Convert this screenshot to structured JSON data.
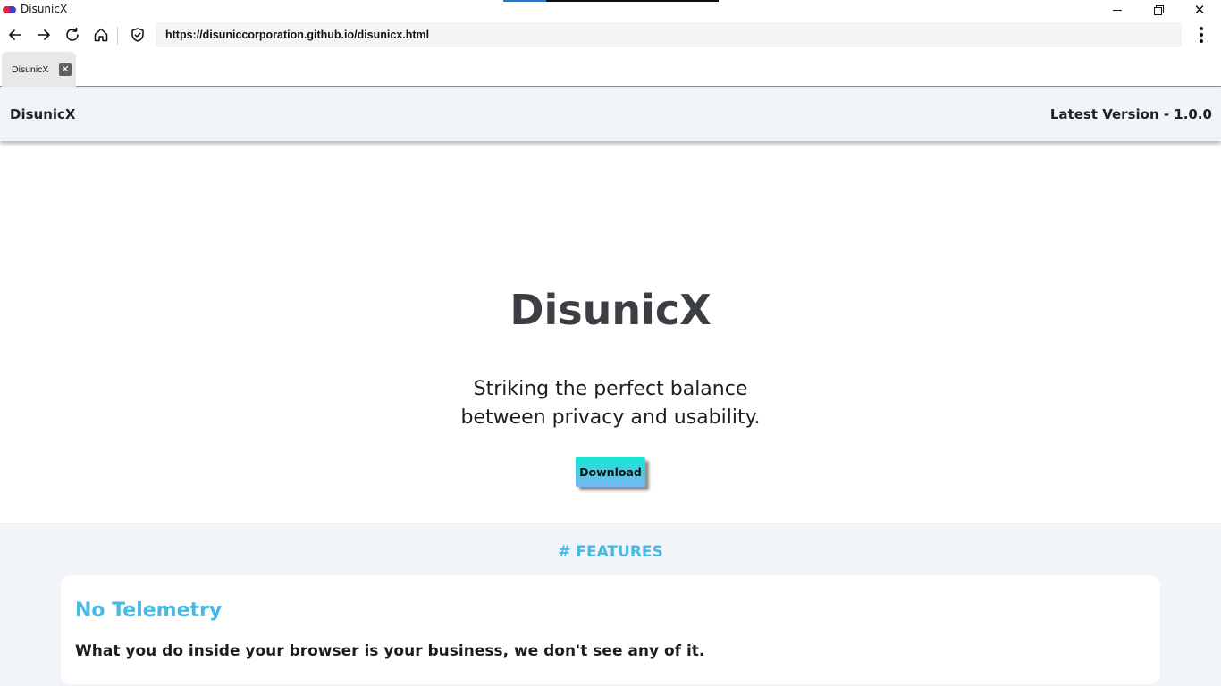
{
  "window": {
    "title": "DisunicX",
    "controls": [
      "minimize",
      "restore",
      "close"
    ]
  },
  "toolbar": {
    "url": "https://disuniccorporation.github.io/disunicx.html",
    "icons": [
      "back-arrow-icon",
      "forward-arrow-icon",
      "reload-icon",
      "home-icon",
      "shield-icon",
      "kebab-menu-icon"
    ]
  },
  "tabs": [
    {
      "label": "DisunicX",
      "close_label": "✕"
    }
  ],
  "site_nav": {
    "brand": "DisunicX",
    "version": "Latest Version - 1.0.0"
  },
  "hero": {
    "title": "DisunicX",
    "tagline_line1": "Striking the perfect balance",
    "tagline_line2": "between privacy and usability.",
    "download_label": "Download"
  },
  "features": {
    "heading": "# FEATURES",
    "items": [
      {
        "title": "No Telemetry",
        "description": "What you do inside your browser is your business, we don't see any of it."
      }
    ]
  },
  "colors": {
    "accent": "#49b8e2",
    "nav_bg": "#f1f4f8",
    "title_text": "#3b3f44",
    "button_gradient_top": "#16e6d3",
    "button_gradient_bottom": "#79b7f5"
  }
}
